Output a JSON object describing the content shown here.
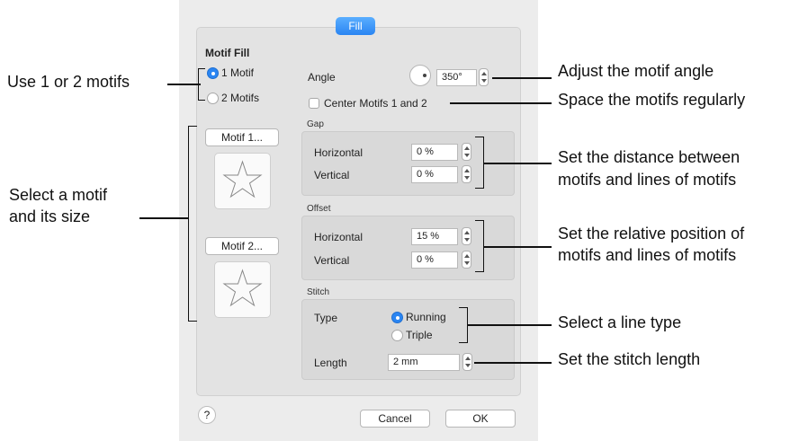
{
  "dialog": {
    "tab_label": "Fill",
    "motif_fill_heading": "Motif Fill",
    "radio_1_motif": "1 Motif",
    "radio_2_motifs": "2 Motifs",
    "motif1_button": "Motif 1...",
    "motif2_button": "Motif 2...",
    "angle_label": "Angle",
    "angle_value": "350°",
    "center_motifs_label": "Center Motifs 1 and 2",
    "gap": {
      "title": "Gap",
      "horizontal_label": "Horizontal",
      "horizontal_value": "0 %",
      "vertical_label": "Vertical",
      "vertical_value": "0 %"
    },
    "offset": {
      "title": "Offset",
      "horizontal_label": "Horizontal",
      "horizontal_value": "15 %",
      "vertical_label": "Vertical",
      "vertical_value": "0 %"
    },
    "stitch": {
      "title": "Stitch",
      "type_label": "Type",
      "running_label": "Running",
      "triple_label": "Triple",
      "length_label": "Length",
      "length_value": "2 mm"
    },
    "help_label": "?",
    "cancel_label": "Cancel",
    "ok_label": "OK"
  },
  "annotations": {
    "use_motifs": "Use 1 or 2 motifs",
    "select_motif_1": "Select a motif",
    "select_motif_2": "and its size",
    "adjust_angle": "Adjust the motif angle",
    "space_regularly": "Space the motifs regularly",
    "gap_1": "Set the distance between",
    "gap_2": "motifs and lines of motifs",
    "offset_1": "Set the relative position of",
    "offset_2": "motifs and lines of motifs",
    "line_type": "Select a line type",
    "stitch_length": "Set the stitch length"
  },
  "colors": {
    "accent": "#2a85f2",
    "dialog_bg": "#ececec"
  }
}
